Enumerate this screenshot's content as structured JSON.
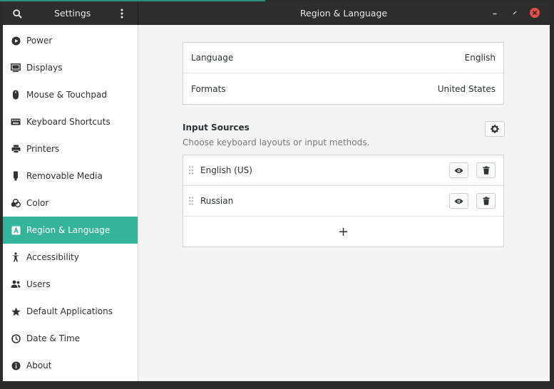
{
  "colors": {
    "accent": "#34b49a",
    "header_bg": "#2d2d2d",
    "close": "#e54c4c"
  },
  "header": {
    "search_icon": "search-icon",
    "app_title": "Settings",
    "menu_icon": "vertical-dots-icon",
    "page_title": "Region & Language",
    "minimize_icon": "minimize-icon",
    "maximize_icon": "maximize-icon",
    "close_icon": "close-icon"
  },
  "sidebar": {
    "items": [
      {
        "label": "Power",
        "icon": "power-icon"
      },
      {
        "label": "Displays",
        "icon": "display-icon"
      },
      {
        "label": "Mouse & Touchpad",
        "icon": "mouse-icon"
      },
      {
        "label": "Keyboard Shortcuts",
        "icon": "keyboard-icon"
      },
      {
        "label": "Printers",
        "icon": "printer-icon"
      },
      {
        "label": "Removable Media",
        "icon": "usb-drive-icon"
      },
      {
        "label": "Color",
        "icon": "color-icon"
      },
      {
        "label": "Region & Language",
        "icon": "region-icon",
        "active": true
      },
      {
        "label": "Accessibility",
        "icon": "accessibility-icon"
      },
      {
        "label": "Users",
        "icon": "users-icon"
      },
      {
        "label": "Default Applications",
        "icon": "star-icon"
      },
      {
        "label": "Date & Time",
        "icon": "clock-icon"
      },
      {
        "label": "About",
        "icon": "info-icon"
      }
    ]
  },
  "main": {
    "language": {
      "label": "Language",
      "value": "English"
    },
    "formats": {
      "label": "Formats",
      "value": "United States"
    },
    "input_sources": {
      "title": "Input Sources",
      "subtitle": "Choose keyboard layouts or input methods.",
      "items": [
        {
          "label": "English (US)"
        },
        {
          "label": "Russian"
        }
      ],
      "add_label": "+"
    }
  }
}
